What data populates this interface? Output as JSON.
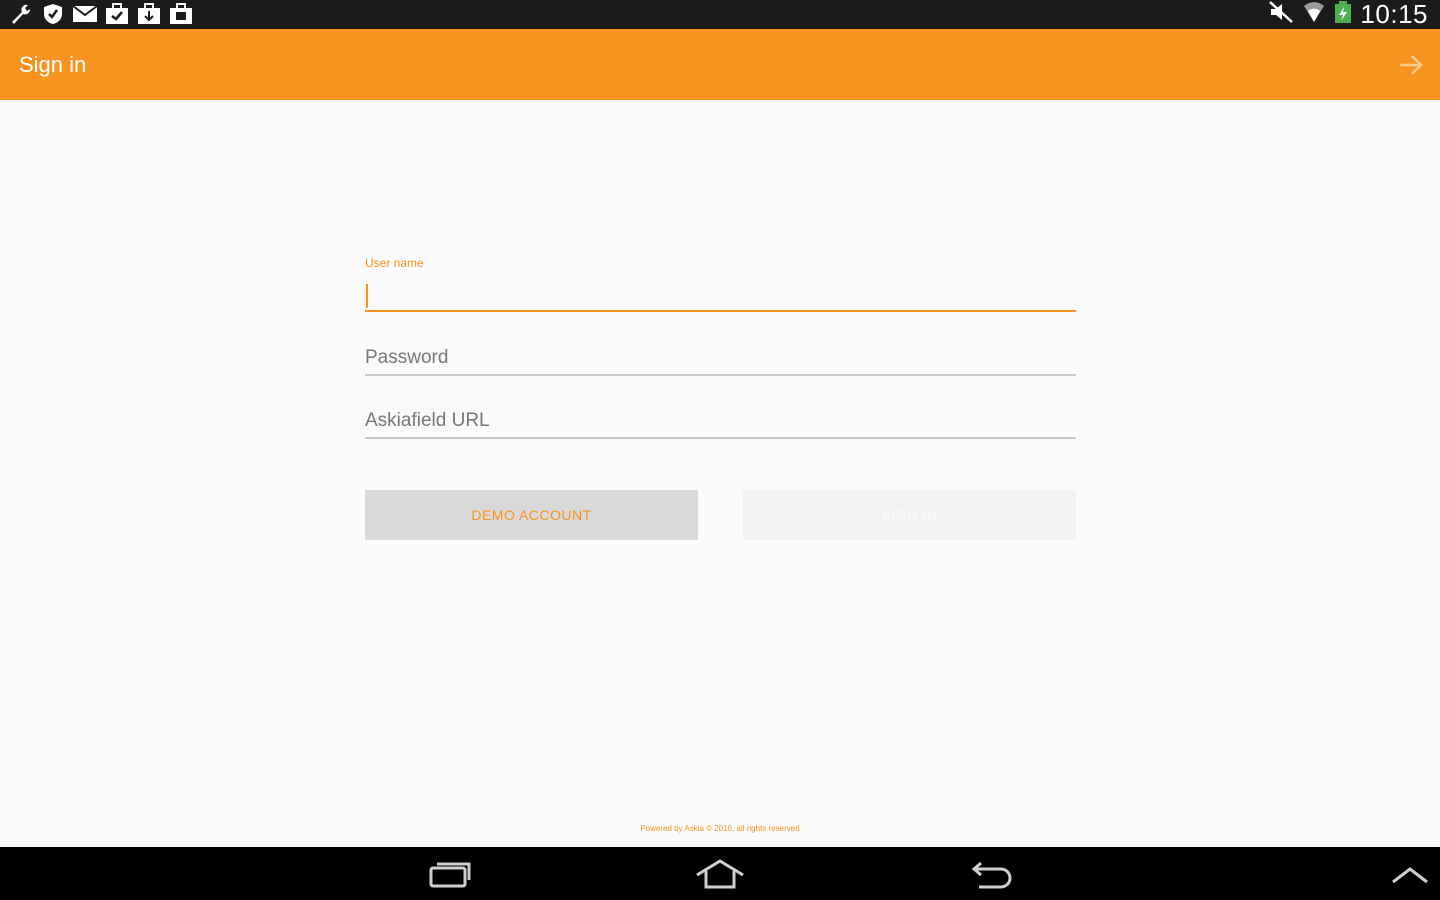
{
  "status_bar": {
    "time": "10:15",
    "left_icons": [
      "wrench-icon",
      "shield-icon",
      "mail-icon",
      "briefcase-check-icon",
      "briefcase-download-icon",
      "briefcase-upload-icon"
    ],
    "right_icons": [
      "mute-icon",
      "wifi-icon",
      "battery-charging-icon"
    ]
  },
  "action_bar": {
    "title": "Sign in",
    "background": "#f7931e"
  },
  "form": {
    "username": {
      "label": "User name",
      "value": ""
    },
    "password": {
      "placeholder": "Password",
      "value": ""
    },
    "url": {
      "placeholder": "Askiafield URL",
      "value": ""
    },
    "demo_button": "DEMO ACCOUNT",
    "signin_button": "SIGN IN"
  },
  "footer": {
    "text": "Powered by Askia © 2016, all rights reserved"
  },
  "nav_bar": {
    "buttons": [
      "recent-apps-icon",
      "home-icon",
      "back-icon",
      "chevron-up-icon"
    ]
  },
  "colors": {
    "accent": "#f7931e",
    "status_bar": "#1b1b1b",
    "nav_bar": "#000000"
  }
}
